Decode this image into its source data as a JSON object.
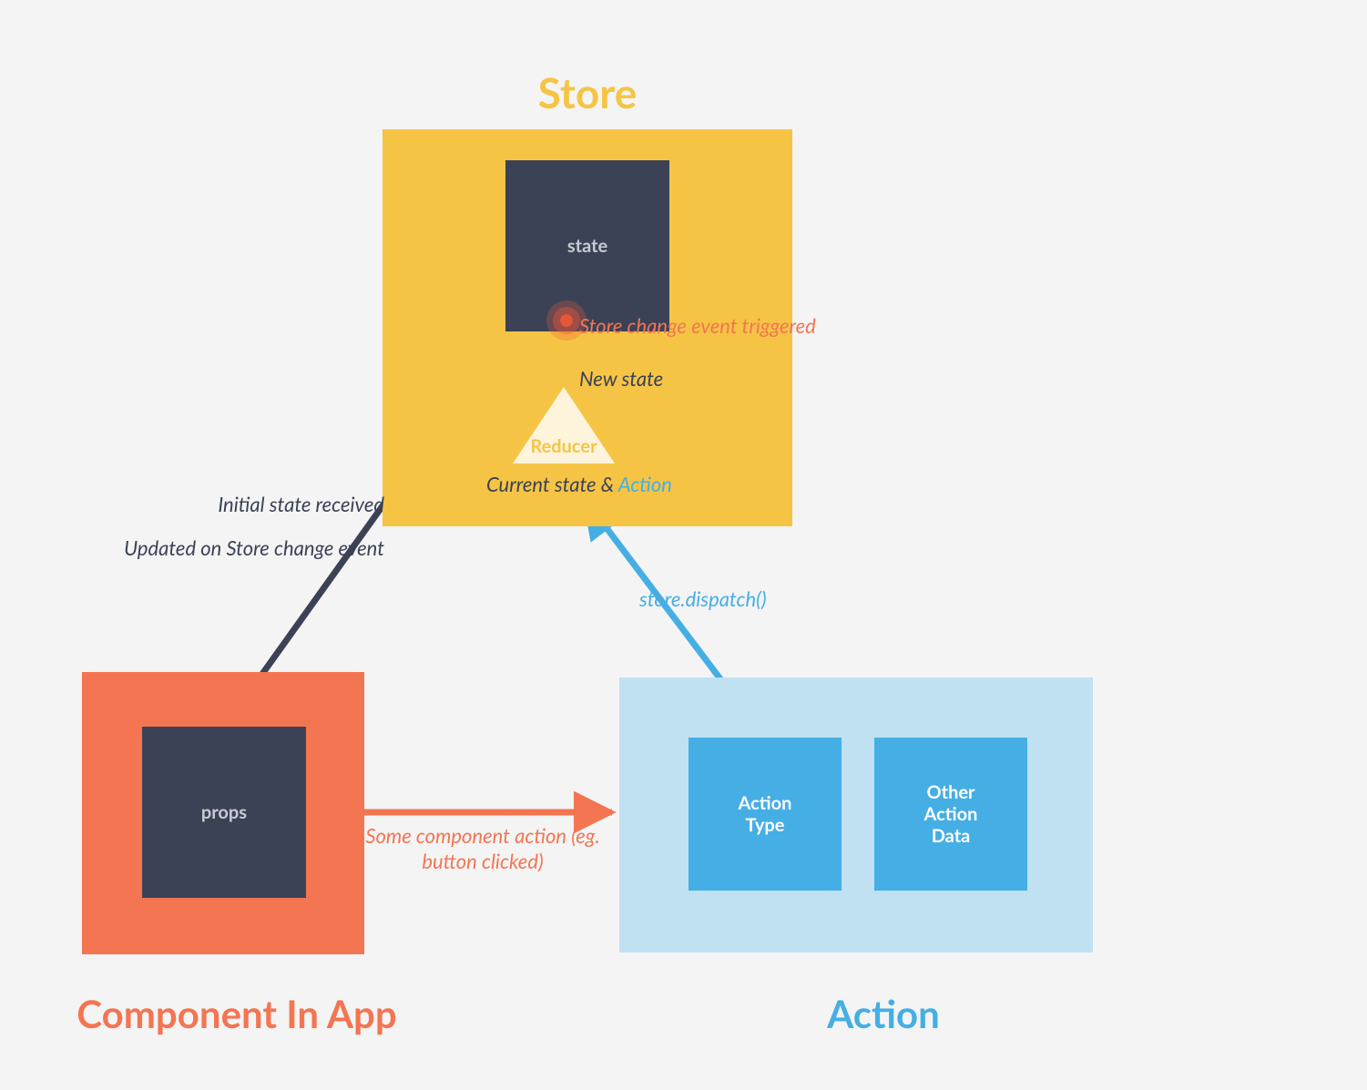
{
  "titles": {
    "store": "Store",
    "component": "Component In App",
    "action": "Action"
  },
  "boxes": {
    "state": "state",
    "props": "props",
    "reducer": "Reducer",
    "action_type": "Action\nType",
    "other_action_data": "Other\nAction\nData"
  },
  "labels": {
    "initial_state_received": "Initial state received",
    "updated_on_store_change_event": "Updated on Store change event",
    "new_state": "New state",
    "current_state_and": "Current state & ",
    "action_word": "Action",
    "store_change_event_triggered": "Store change event triggered",
    "store_dispatch": "store.dispatch()",
    "some_component_action": "Some component action (eg. button clicked)"
  },
  "colors": {
    "yellow": "#f6c445",
    "orange": "#f37552",
    "blue": "#45aee5",
    "lightblue": "#c0e1f2",
    "navy": "#3b4256"
  }
}
